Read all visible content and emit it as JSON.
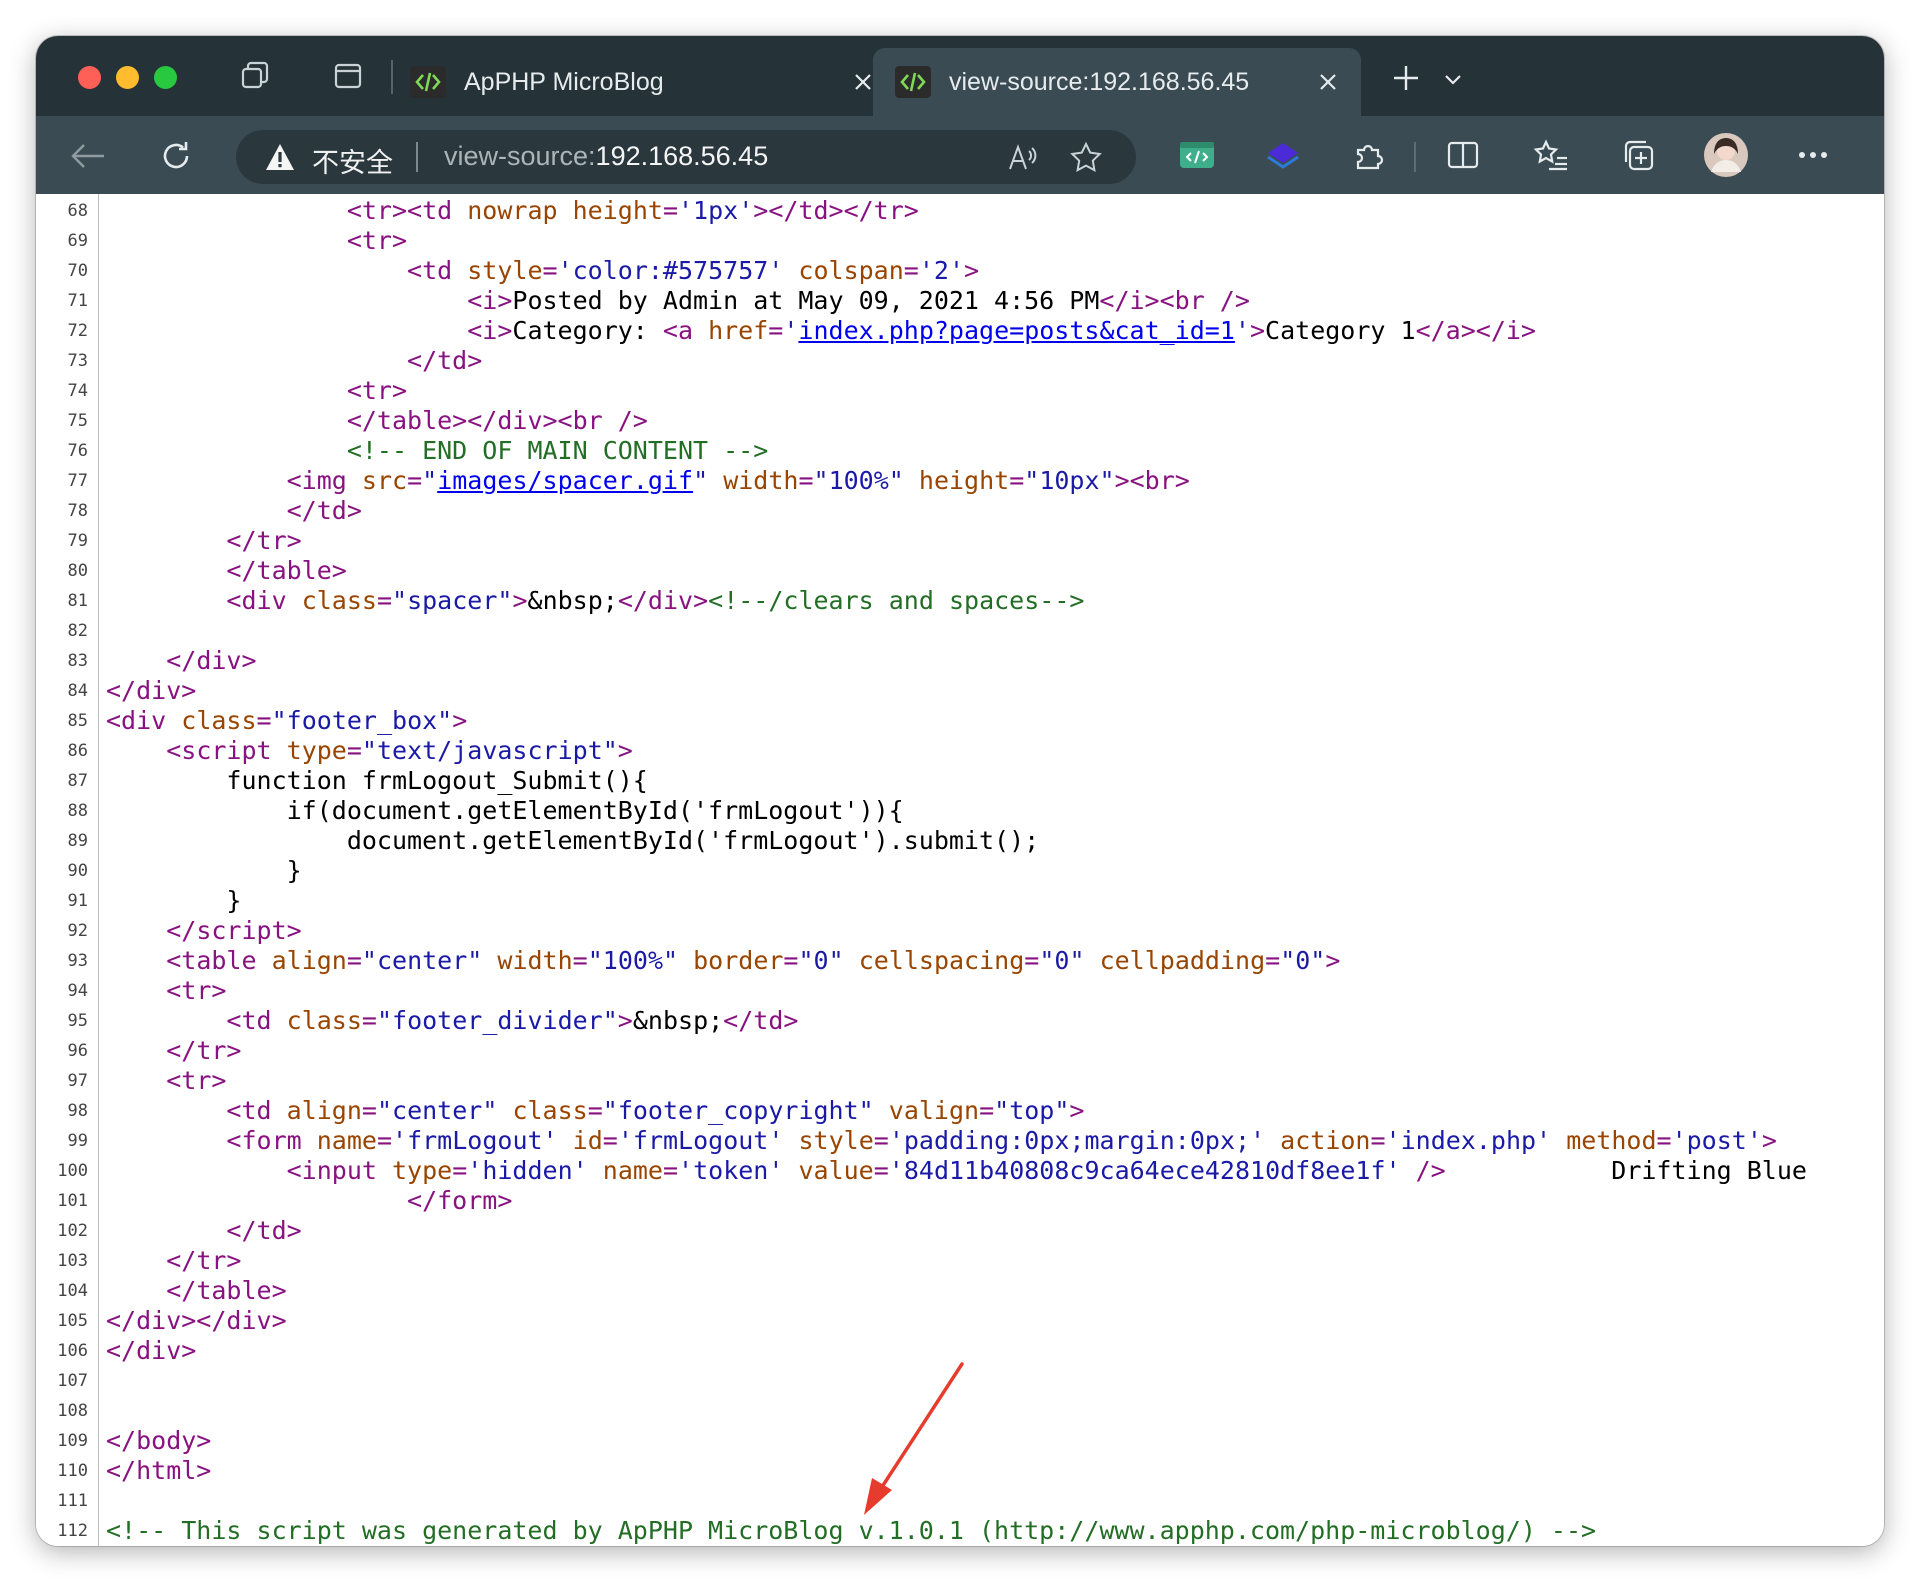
{
  "browser": {
    "tabs": [
      {
        "title": "ApPHP MicroBlog",
        "active": false
      },
      {
        "title": "view-source:192.168.56.45",
        "active": true
      }
    ],
    "address_bar": {
      "security_label": "不安全",
      "url_scheme": "view-source:",
      "url_host": "192.168.56.45"
    }
  },
  "source": {
    "lines": [
      {
        "n": "68",
        "html": "                <span class=\"t\">&lt;tr&gt;&lt;td</span> <span class=\"a\">nowrap</span> <span class=\"a\">height</span><span class=\"t\">=</span><span class=\"v\">'1px'</span><span class=\"t\">&gt;&lt;/td&gt;&lt;/tr&gt;</span>"
      },
      {
        "n": "69",
        "html": "                <span class=\"t\">&lt;tr&gt;</span>"
      },
      {
        "n": "70",
        "html": "                    <span class=\"t\">&lt;td</span> <span class=\"a\">style</span><span class=\"t\">=</span><span class=\"v\">'color:#575757'</span> <span class=\"a\">colspan</span><span class=\"t\">=</span><span class=\"v\">'2'</span><span class=\"t\">&gt;</span>"
      },
      {
        "n": "71",
        "html": "                        <span class=\"t\">&lt;i&gt;</span>Posted by Admin at May 09, 2021 4:56 PM<span class=\"t\">&lt;/i&gt;&lt;br /&gt;</span>"
      },
      {
        "n": "72",
        "html": "                        <span class=\"t\">&lt;i&gt;</span>Category: <span class=\"t\">&lt;a</span> <span class=\"a\">href</span><span class=\"t\">=</span><span class=\"v\">'</span><span class=\"l\">index.php?page=posts&amp;cat_id=1</span><span class=\"v\">'</span><span class=\"t\">&gt;</span>Category 1<span class=\"t\">&lt;/a&gt;&lt;/i&gt;</span>"
      },
      {
        "n": "73",
        "html": "                    <span class=\"t\">&lt;/td&gt;</span>"
      },
      {
        "n": "74",
        "html": "                <span class=\"t\">&lt;tr&gt;</span>"
      },
      {
        "n": "75",
        "html": "                <span class=\"t\">&lt;/table&gt;&lt;/div&gt;&lt;br /&gt;</span>"
      },
      {
        "n": "76",
        "html": "                <span class=\"c\">&lt;!-- END OF MAIN CONTENT --&gt;</span>"
      },
      {
        "n": "77",
        "html": "            <span class=\"t\">&lt;img</span> <span class=\"a\">src</span><span class=\"t\">=</span><span class=\"v\">\"</span><span class=\"l\">images/spacer.gif</span><span class=\"v\">\"</span> <span class=\"a\">width</span><span class=\"t\">=</span><span class=\"v\">\"100%\"</span> <span class=\"a\">height</span><span class=\"t\">=</span><span class=\"v\">\"10px\"</span><span class=\"t\">&gt;&lt;br&gt;</span>"
      },
      {
        "n": "78",
        "html": "            <span class=\"t\">&lt;/td&gt;</span>"
      },
      {
        "n": "79",
        "html": "        <span class=\"t\">&lt;/tr&gt;</span>"
      },
      {
        "n": "80",
        "html": "        <span class=\"t\">&lt;/table&gt;</span>"
      },
      {
        "n": "81",
        "html": "        <span class=\"t\">&lt;div</span> <span class=\"a\">class</span><span class=\"t\">=</span><span class=\"v\">\"spacer\"</span><span class=\"t\">&gt;</span>&amp;nbsp;<span class=\"t\">&lt;/div&gt;</span><span class=\"c\">&lt;!--/clears and spaces--&gt;</span>"
      },
      {
        "n": "82",
        "html": ""
      },
      {
        "n": "83",
        "html": "    <span class=\"t\">&lt;/div&gt;</span>"
      },
      {
        "n": "84",
        "html": "<span class=\"t\">&lt;/div&gt;</span>"
      },
      {
        "n": "85",
        "html": "<span class=\"t\">&lt;div</span> <span class=\"a\">class</span><span class=\"t\">=</span><span class=\"v\">\"footer_box\"</span><span class=\"t\">&gt;</span>"
      },
      {
        "n": "86",
        "html": "    <span class=\"t\">&lt;script</span> <span class=\"a\">type</span><span class=\"t\">=</span><span class=\"v\">\"text/javascript\"</span><span class=\"t\">&gt;</span>"
      },
      {
        "n": "87",
        "html": "        function frmLogout_Submit(){"
      },
      {
        "n": "88",
        "html": "            if(document.getElementById('frmLogout')){"
      },
      {
        "n": "89",
        "html": "                document.getElementById('frmLogout').submit();"
      },
      {
        "n": "90",
        "html": "            }"
      },
      {
        "n": "91",
        "html": "        }"
      },
      {
        "n": "92",
        "html": "    <span class=\"t\">&lt;/script&gt;</span>"
      },
      {
        "n": "93",
        "html": "    <span class=\"t\">&lt;table</span> <span class=\"a\">align</span><span class=\"t\">=</span><span class=\"v\">\"center\"</span> <span class=\"a\">width</span><span class=\"t\">=</span><span class=\"v\">\"100%\"</span> <span class=\"a\">border</span><span class=\"t\">=</span><span class=\"v\">\"0\"</span> <span class=\"a\">cellspacing</span><span class=\"t\">=</span><span class=\"v\">\"0\"</span> <span class=\"a\">cellpadding</span><span class=\"t\">=</span><span class=\"v\">\"0\"</span><span class=\"t\">&gt;</span>"
      },
      {
        "n": "94",
        "html": "    <span class=\"t\">&lt;tr&gt;</span>"
      },
      {
        "n": "95",
        "html": "        <span class=\"t\">&lt;td</span> <span class=\"a\">class</span><span class=\"t\">=</span><span class=\"v\">\"footer_divider\"</span><span class=\"t\">&gt;</span>&amp;nbsp;<span class=\"t\">&lt;/td&gt;</span>"
      },
      {
        "n": "96",
        "html": "    <span class=\"t\">&lt;/tr&gt;</span>"
      },
      {
        "n": "97",
        "html": "    <span class=\"t\">&lt;tr&gt;</span>"
      },
      {
        "n": "98",
        "html": "        <span class=\"t\">&lt;td</span> <span class=\"a\">align</span><span class=\"t\">=</span><span class=\"v\">\"center\"</span> <span class=\"a\">class</span><span class=\"t\">=</span><span class=\"v\">\"footer_copyright\"</span> <span class=\"a\">valign</span><span class=\"t\">=</span><span class=\"v\">\"top\"</span><span class=\"t\">&gt;</span>"
      },
      {
        "n": "99",
        "html": "        <span class=\"t\">&lt;form</span> <span class=\"a\">name</span><span class=\"t\">=</span><span class=\"v\">'frmLogout'</span> <span class=\"a\">id</span><span class=\"t\">=</span><span class=\"v\">'frmLogout'</span> <span class=\"a\">style</span><span class=\"t\">=</span><span class=\"v\">'padding:0px;margin:0px;'</span> <span class=\"a\">action</span><span class=\"t\">=</span><span class=\"v\">'index.php'</span> <span class=\"a\">method</span><span class=\"t\">=</span><span class=\"v\">'post'</span><span class=\"t\">&gt;</span>"
      },
      {
        "n": "100",
        "html": "            <span class=\"t\">&lt;input</span> <span class=\"a\">type</span><span class=\"t\">=</span><span class=\"v\">'hidden'</span> <span class=\"a\">name</span><span class=\"t\">=</span><span class=\"v\">'token'</span> <span class=\"a\">value</span><span class=\"t\">=</span><span class=\"v\">'84d11b40808c9ca64ece42810df8ee1f'</span> <span class=\"t\">/&gt;</span>           Drifting Blue"
      },
      {
        "n": "101",
        "html": "                    <span class=\"t\">&lt;/form&gt;</span>"
      },
      {
        "n": "102",
        "html": "        <span class=\"t\">&lt;/td&gt;</span>"
      },
      {
        "n": "103",
        "html": "    <span class=\"t\">&lt;/tr&gt;</span>"
      },
      {
        "n": "104",
        "html": "    <span class=\"t\">&lt;/table&gt;</span>"
      },
      {
        "n": "105",
        "html": "<span class=\"t\">&lt;/div&gt;&lt;/div&gt;</span>"
      },
      {
        "n": "106",
        "html": "<span class=\"t\">&lt;/div&gt;</span>"
      },
      {
        "n": "107",
        "html": ""
      },
      {
        "n": "108",
        "html": ""
      },
      {
        "n": "109",
        "html": "<span class=\"t\">&lt;/body&gt;</span>"
      },
      {
        "n": "110",
        "html": "<span class=\"t\">&lt;/html&gt;</span>"
      },
      {
        "n": "111",
        "html": ""
      },
      {
        "n": "112",
        "html": "<span class=\"c\">&lt;!-- This script was generated by ApPHP MicroBlog v.1.0.1 (http://www.apphp.com/php-microblog/) --&gt;</span>"
      }
    ]
  }
}
